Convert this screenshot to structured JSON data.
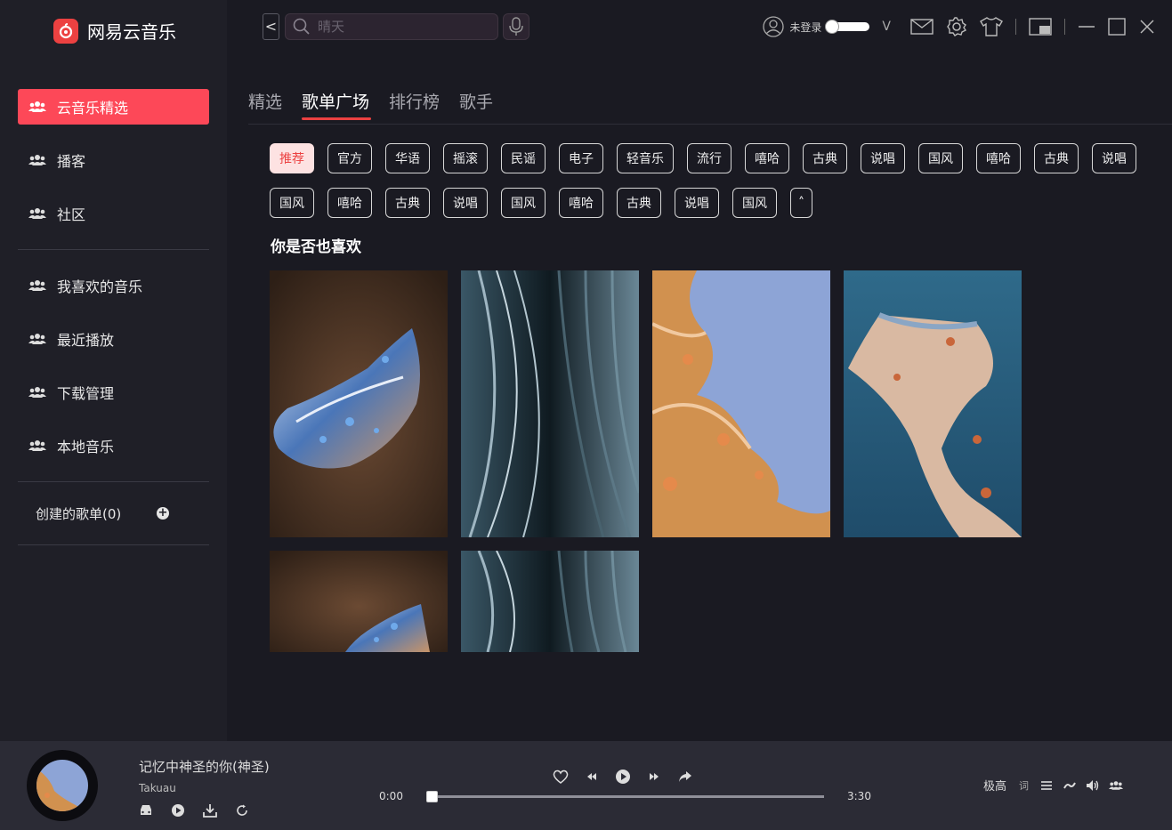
{
  "app": {
    "name": "网易云音乐",
    "accent": "#ec4141"
  },
  "sidebar": {
    "items": [
      {
        "label": "云音乐精选",
        "active": true,
        "icon": "people-icon"
      },
      {
        "label": "播客",
        "icon": "people-icon"
      },
      {
        "label": "社区",
        "icon": "people-icon"
      }
    ],
    "my_items": [
      {
        "label": "我喜欢的音乐",
        "icon": "people-icon"
      },
      {
        "label": "最近播放",
        "icon": "people-icon"
      },
      {
        "label": "下载管理",
        "icon": "people-icon"
      },
      {
        "label": "本地音乐",
        "icon": "people-icon"
      }
    ],
    "create_playlist": "创建的歌单(0)"
  },
  "topbar": {
    "back": "<",
    "search_placeholder": "晴天",
    "login_text": "未登录",
    "login_dropdown": "V"
  },
  "tabs": [
    {
      "label": "精选"
    },
    {
      "label": "歌单广场",
      "active": true
    },
    {
      "label": "排行榜"
    },
    {
      "label": "歌手"
    }
  ],
  "tags_row1": [
    "推荐",
    "官方",
    "华语",
    "摇滚",
    "民谣",
    "电子",
    "轻音乐",
    "流行",
    "嘻哈",
    "古典",
    "说唱",
    "国风",
    "嘻哈",
    "古典",
    "说唱"
  ],
  "tags_row2": [
    "国风",
    "嘻哈",
    "古典",
    "说唱",
    "国风",
    "嘻哈",
    "古典",
    "说唱",
    "国风",
    "˄"
  ],
  "section_title": "你是否也喜欢",
  "player": {
    "song_title": "记忆中神圣的你(神圣)",
    "artist": "Takuau",
    "time_current": "0:00",
    "time_total": "3:30",
    "progress": 0.0,
    "quality": "极高",
    "lyric_label": "词"
  }
}
